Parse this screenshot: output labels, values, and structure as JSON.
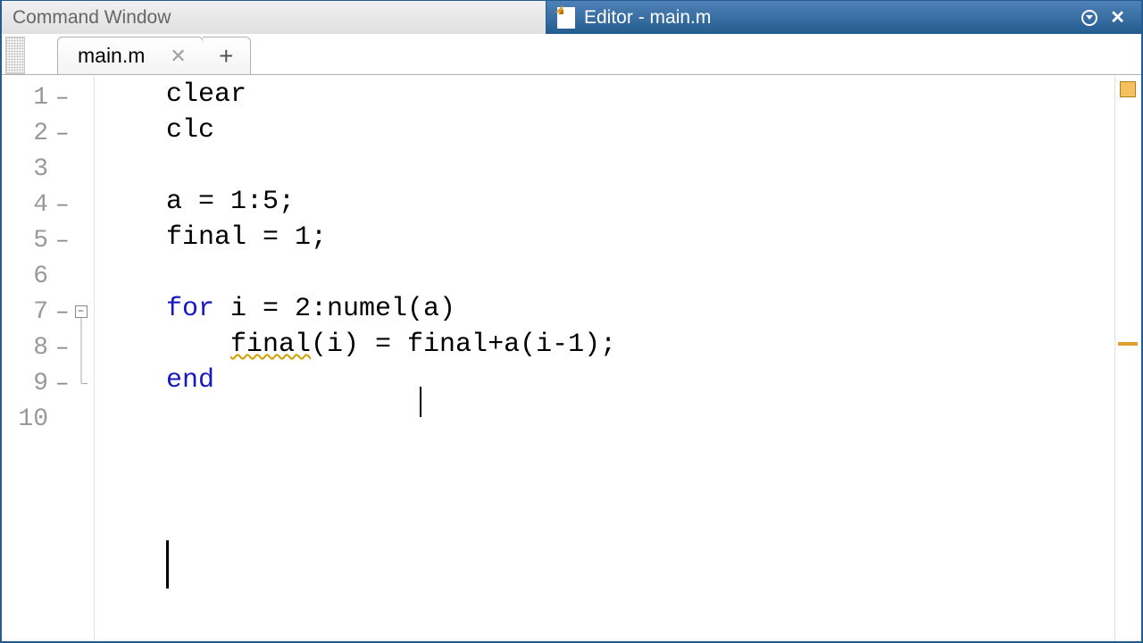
{
  "titleTabs": {
    "inactive": "Command Window",
    "activePrefix": "Editor - ",
    "activeFile": "main.m"
  },
  "fileTab": {
    "name": "main.m"
  },
  "code": {
    "lines": [
      {
        "n": "1",
        "dash": true,
        "text": "clear"
      },
      {
        "n": "2",
        "dash": true,
        "text": "clc"
      },
      {
        "n": "3",
        "dash": false,
        "text": ""
      },
      {
        "n": "4",
        "dash": true,
        "text": "a = 1:5;"
      },
      {
        "n": "5",
        "dash": true,
        "text": "final = 1;"
      },
      {
        "n": "6",
        "dash": false,
        "text": ""
      },
      {
        "n": "7",
        "dash": true,
        "kw1": "for",
        "rest7": " i = 2:numel(a)"
      },
      {
        "n": "8",
        "dash": true,
        "indent8": "    ",
        "warn": "final",
        "rest8": "(i) = final+a(i-1);"
      },
      {
        "n": "9",
        "dash": true,
        "kw9": "end"
      },
      {
        "n": "10",
        "dash": false,
        "text": ""
      }
    ]
  }
}
